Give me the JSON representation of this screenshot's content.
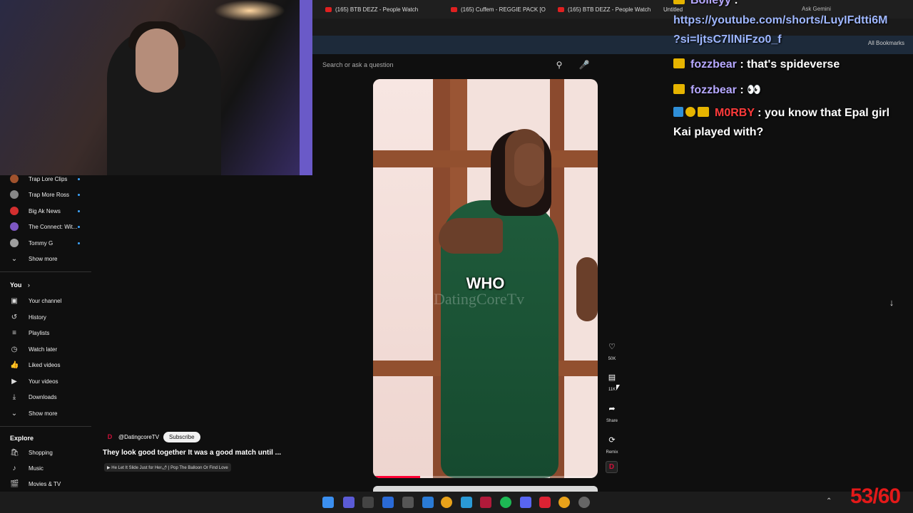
{
  "browser": {
    "tabs": [
      {
        "label": "(165) BTB DEZZ - People Watch"
      },
      {
        "label": "(165) Cuffem - REGGIE PACK [O"
      },
      {
        "label": "(165) BTB DEZZ - People Watch"
      },
      {
        "label": "Untitled"
      }
    ],
    "all_bookmarks": "All Bookmarks",
    "ask_gemini": "Ask Gemini"
  },
  "search": {
    "placeholder": "Search or ask a question"
  },
  "sidebar": {
    "subscriptions": [
      {
        "label": "Trap Lore Clips",
        "color": "#a0522d"
      },
      {
        "label": "Trap More Ross",
        "color": "#888888"
      },
      {
        "label": "Big Ak News",
        "color": "#d32f2f"
      },
      {
        "label": "The Connect: Wit...",
        "color": "#7e57c2"
      },
      {
        "label": "Tommy G",
        "color": "#9e9e9e"
      }
    ],
    "show_more_1": "Show more",
    "you_title": "You",
    "you_items": [
      {
        "label": "Your channel",
        "icon": "▣"
      },
      {
        "label": "History",
        "icon": "↺"
      },
      {
        "label": "Playlists",
        "icon": "≡"
      },
      {
        "label": "Watch later",
        "icon": "◷"
      },
      {
        "label": "Liked videos",
        "icon": "👍"
      },
      {
        "label": "Your videos",
        "icon": "▶"
      },
      {
        "label": "Downloads",
        "icon": "⤓"
      }
    ],
    "show_more_2": "Show more",
    "explore_title": "Explore",
    "explore_items": [
      {
        "label": "Shopping",
        "icon": "🛍"
      },
      {
        "label": "Music",
        "icon": "♪"
      },
      {
        "label": "Movies & TV",
        "icon": "🎬"
      }
    ]
  },
  "short": {
    "caption": "WHO",
    "watermark": "DatingCoreTv",
    "progress": 0.21,
    "channel": "@DatingcoreTV",
    "channel_logo": "D",
    "subscribe": "Subscribe",
    "title": "They look good together It was a good match until ...",
    "sound": "▶ He Let It Slide Just for Her🌶 | Pop The Balloon Or Find Love",
    "actions": {
      "like_count": "50K",
      "comment_count": "11K",
      "share": "Share",
      "remix": "Remix"
    }
  },
  "chat": {
    "lines": [
      {
        "user": "Bolleyy",
        "message": ""
      },
      {
        "link": "https://youtube.com/shorts/LuyIFdtti6M",
        "link2": "?si=ljtsC7llNiFzo0_f"
      },
      {
        "user": "fozzbear",
        "message": "that's spideverse"
      },
      {
        "user": "fozzbear",
        "message": "👀"
      },
      {
        "user": "M0RBY",
        "message": "you know that Epal girl",
        "message2": "Kai played with?"
      }
    ]
  },
  "taskbar": {
    "fps": "53/60"
  },
  "colors": {
    "accent_red": "#ff0033",
    "chat_user": "#b6a8ff",
    "fps": "#e31919"
  }
}
